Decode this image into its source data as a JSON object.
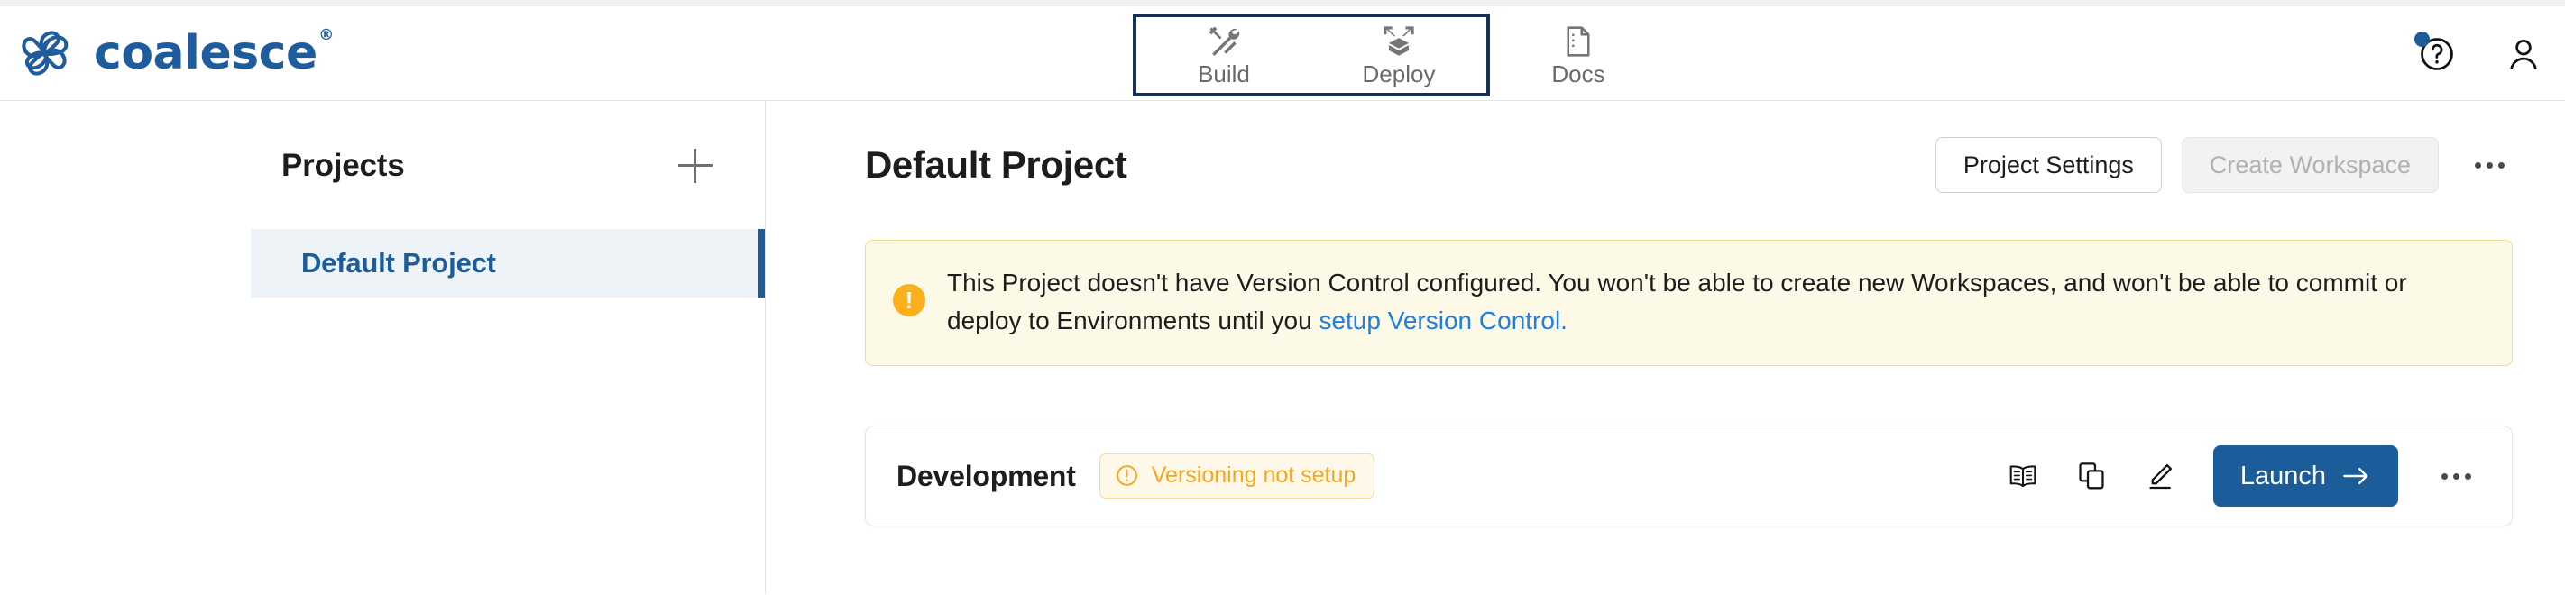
{
  "brand": {
    "name": "coalesce",
    "registered_mark": "®",
    "logo_icon": "coalesce-spiral-logo",
    "color": "#1f5c9e"
  },
  "nav": {
    "highlight_color": "#153053",
    "items": [
      {
        "label": "Build",
        "icon": "tools-icon",
        "active": true,
        "grouped": true
      },
      {
        "label": "Deploy",
        "icon": "deploy-box-icon",
        "active": false,
        "grouped": true
      },
      {
        "label": "Docs",
        "icon": "document-icon",
        "active": false,
        "grouped": false
      }
    ]
  },
  "header_right": {
    "help_icon": "question-circle-icon",
    "help_badge_color": "#1b5c9b",
    "account_icon": "user-avatar-icon"
  },
  "sidebar": {
    "title": "Projects",
    "add_icon": "plus-icon",
    "items": [
      {
        "label": "Default Project",
        "selected": true
      }
    ],
    "selected_accent": "#1b5c9b",
    "selected_bg": "#eef3f8"
  },
  "main": {
    "title": "Default Project",
    "actions": {
      "project_settings": "Project Settings",
      "create_workspace": "Create Workspace",
      "create_workspace_disabled": true,
      "overflow_icon": "ellipsis-icon"
    }
  },
  "banner": {
    "icon": "warning-exclamation-icon",
    "icon_color": "#fbaf1d",
    "bg_color": "#fdf9e7",
    "text_before": "This Project doesn't have Version Control configured. You won't be able to create new Workspaces, and won't be able to commit or deploy to Environments until you ",
    "link_text": "setup Version Control.",
    "link_color": "#1f7fe0"
  },
  "workspace": {
    "name": "Development",
    "badge": {
      "text": "Versioning not setup",
      "icon": "alert-circle-icon",
      "color": "#f5a623"
    },
    "actions": {
      "docs_icon": "book-icon",
      "duplicate_icon": "copy-icon",
      "edit_icon": "pencil-icon",
      "launch_label": "Launch",
      "launch_arrow": "arrow-right-icon",
      "launch_color": "#1b5c9b",
      "overflow_icon": "ellipsis-icon"
    }
  }
}
